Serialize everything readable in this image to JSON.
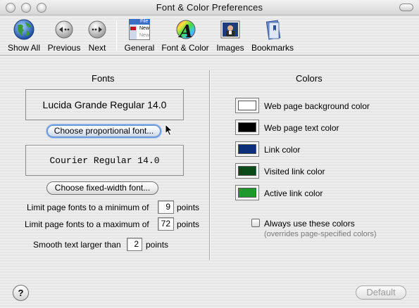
{
  "window": {
    "title": "Font & Color Preferences"
  },
  "toolbar": {
    "items": [
      {
        "label": "Show All",
        "icon": "globe-icon"
      },
      {
        "label": "Previous",
        "icon": "previous-arrow-icon"
      },
      {
        "label": "Next",
        "icon": "next-arrow-icon"
      },
      {
        "label": "General",
        "icon": "general-prefs-icon"
      },
      {
        "label": "Font & Color",
        "icon": "font-color-icon"
      },
      {
        "label": "Images",
        "icon": "images-icon"
      },
      {
        "label": "Bookmarks",
        "icon": "bookmarks-icon"
      }
    ],
    "general_icon_text": {
      "file": "File",
      "new": "New",
      "new2": "New"
    },
    "font_color_icon_letter": "A"
  },
  "fonts": {
    "heading": "Fonts",
    "proportional_font": "Lucida Grande Regular 14.0",
    "proportional_button": "Choose proportional font...",
    "fixed_font": "Courier Regular 14.0",
    "fixed_button": "Choose fixed-width font...",
    "min_label": "Limit page fonts to a minimum of",
    "min_value": "9",
    "min_unit": "points",
    "max_label": "Limit page fonts to a maximum of",
    "max_value": "72",
    "max_unit": "points",
    "smooth_label": "Smooth text larger than",
    "smooth_value": "2",
    "smooth_unit": "points"
  },
  "colors": {
    "heading": "Colors",
    "swatches": [
      {
        "label": "Web page background color",
        "color": "#ffffff"
      },
      {
        "label": "Web page text color",
        "color": "#000000"
      },
      {
        "label": "Link color",
        "color": "#0d2f7a"
      },
      {
        "label": "Visited link color",
        "color": "#0a4a18"
      },
      {
        "label": "Active link color",
        "color": "#1e9a2c"
      }
    ],
    "always_use_label": "Always use these colors",
    "always_use_note": "(overrides page-specified colors)",
    "always_use_checked": false
  },
  "footer": {
    "help_label": "?",
    "default_label": "Default"
  }
}
